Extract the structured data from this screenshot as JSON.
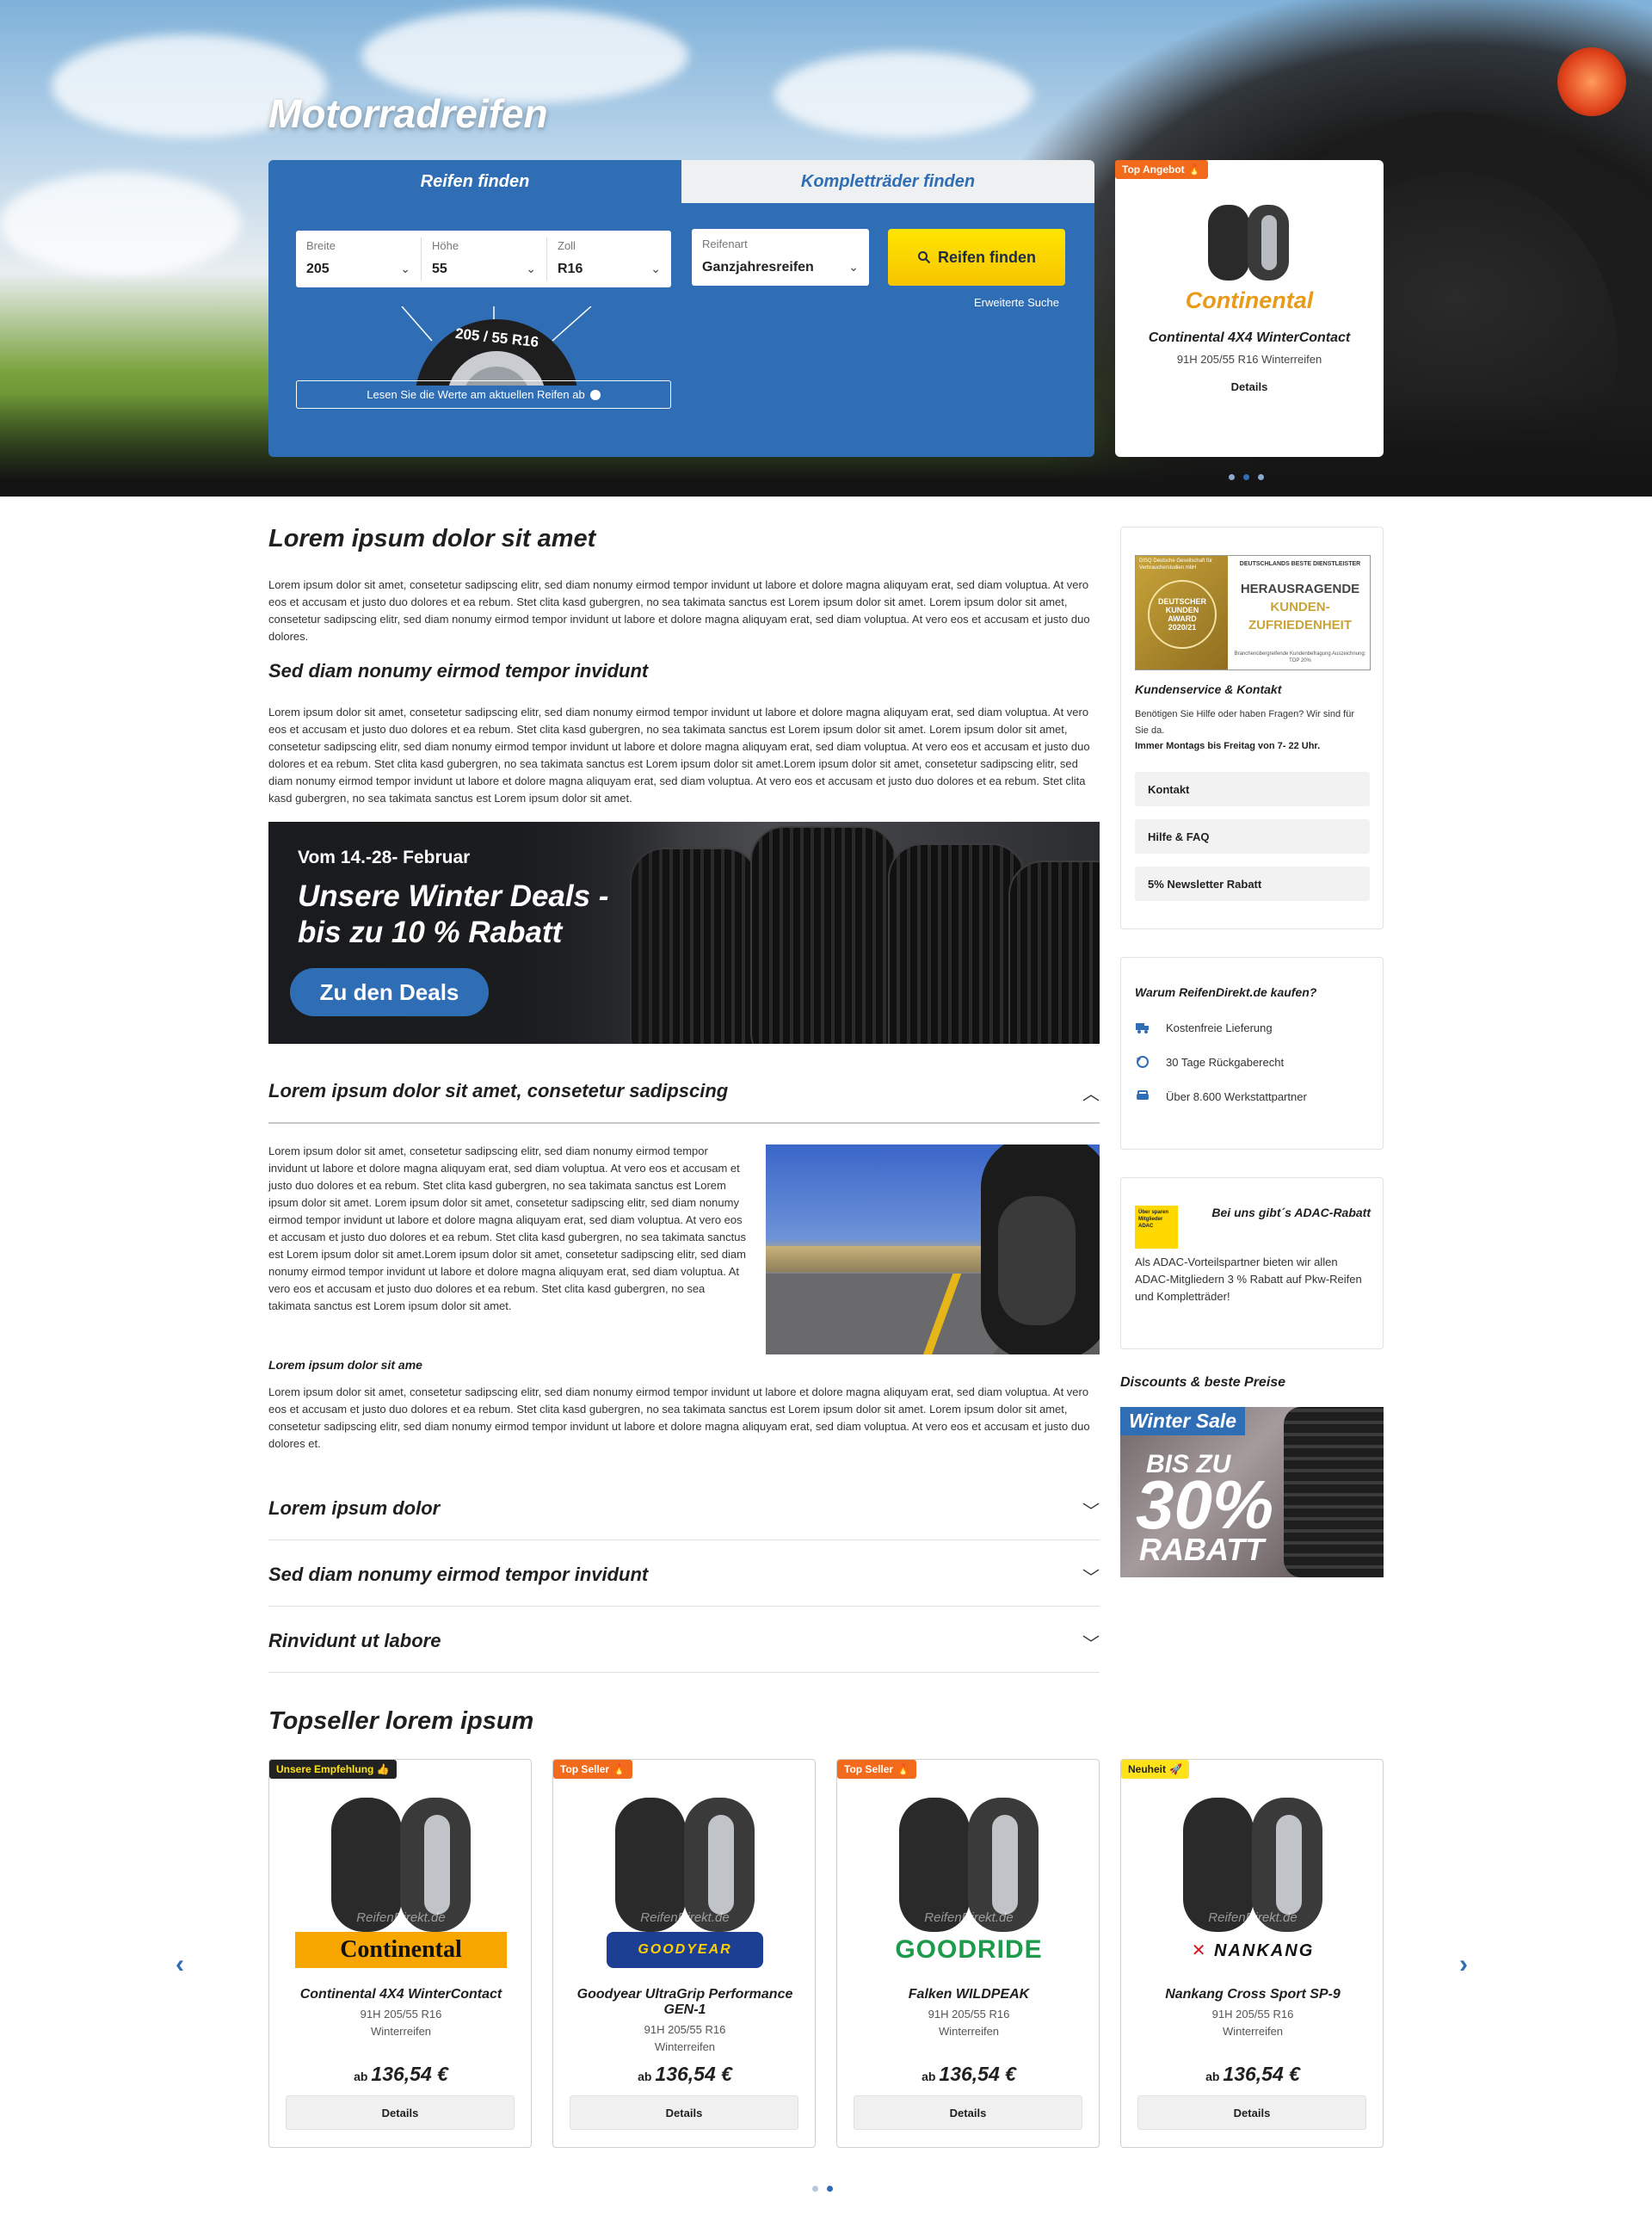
{
  "hero": {
    "title": "Motorradreifen",
    "tabs": [
      "Reifen finden",
      "Kompletträder finden"
    ],
    "fields": {
      "breite": {
        "label": "Breite",
        "value": "205"
      },
      "hoehe": {
        "label": "Höhe",
        "value": "55"
      },
      "zoll": {
        "label": "Zoll",
        "value": "R16"
      },
      "reifenart": {
        "label": "Reifenart",
        "value": "Ganzjahresreifen"
      }
    },
    "find_button": "Reifen finden",
    "advanced_search": "Erweiterte Suche",
    "tire_size_label": "205 / 55 R16",
    "read_values": "Lesen Sie die Werte am aktuellen Reifen ab"
  },
  "top_offer": {
    "badge": "Top Angebot",
    "brand": "Continental",
    "name": "Continental 4X4 WinterContact",
    "spec": "91H 205/55 R16 Winterreifen",
    "details": "Details"
  },
  "content": {
    "h1": "Lorem ipsum dolor sit amet",
    "p1": "Lorem ipsum dolor sit amet, consetetur sadipscing elitr, sed diam nonumy eirmod tempor invidunt ut labore et dolore magna aliquyam erat, sed diam voluptua. At vero eos et accusam et justo duo dolores et ea rebum. Stet clita kasd gubergren, no sea takimata sanctus est Lorem ipsum dolor sit amet. Lorem ipsum dolor sit amet, consetetur sadipscing elitr, sed diam nonumy eirmod tempor invidunt ut labore et dolore magna aliquyam erat, sed diam voluptua. At vero eos et accusam et justo duo dolores.",
    "h2": "Sed diam nonumy eirmod tempor invidunt",
    "p2": "Lorem ipsum dolor sit amet, consetetur sadipscing elitr, sed diam nonumy eirmod tempor invidunt ut labore et dolore magna aliquyam erat, sed diam voluptua. At vero eos et accusam et justo duo dolores et ea rebum. Stet clita kasd gubergren, no sea takimata sanctus est Lorem ipsum dolor sit amet. Lorem ipsum dolor sit amet, consetetur sadipscing elitr, sed diam nonumy eirmod tempor invidunt ut labore et dolore magna aliquyam erat, sed diam voluptua. At vero eos et accusam et justo duo dolores et ea rebum. Stet clita kasd gubergren, no sea takimata sanctus est Lorem ipsum dolor sit amet.Lorem ipsum dolor sit amet, consetetur sadipscing elitr, sed diam nonumy eirmod tempor invidunt ut labore et dolore magna aliquyam erat, sed diam voluptua. At vero eos et accusam et justo duo dolores et ea rebum. Stet clita kasd gubergren, no sea takimata sanctus est Lorem ipsum dolor sit amet.",
    "banner": {
      "date": "Vom 14.-28- Februar",
      "title": "Unsere Winter Deals - bis zu 10 % Rabatt",
      "button": "Zu den Deals"
    },
    "accordion_open": {
      "title": "Lorem ipsum dolor sit amet, consetetur sadipscing",
      "p": "Lorem ipsum dolor sit amet, consetetur sadipscing elitr, sed diam nonumy eirmod tempor invidunt ut labore et dolore magna aliquyam erat, sed diam voluptua. At vero eos et accusam et justo duo dolores et ea rebum. Stet clita kasd gubergren, no sea takimata sanctus est Lorem ipsum dolor sit amet. Lorem ipsum dolor sit amet, consetetur sadipscing elitr, sed diam nonumy eirmod tempor invidunt ut labore et dolore magna aliquyam erat, sed diam voluptua. At vero eos et accusam et justo duo dolores et ea rebum. Stet clita kasd gubergren, no sea takimata sanctus est Lorem ipsum dolor sit amet.Lorem ipsum dolor sit amet, consetetur sadipscing elitr, sed diam nonumy eirmod tempor invidunt ut labore et dolore magna aliquyam erat, sed diam voluptua. At vero eos et accusam et justo duo dolores et ea rebum. Stet clita kasd gubergren, no sea takimata sanctus est Lorem ipsum dolor sit amet.",
      "subhead": "Lorem ipsum dolor sit ame",
      "p2": "Lorem ipsum dolor sit amet, consetetur sadipscing elitr, sed diam nonumy eirmod tempor invidunt ut labore et dolore magna aliquyam erat, sed diam voluptua. At vero eos et accusam et justo duo dolores et ea rebum. Stet clita kasd gubergren, no sea takimata sanctus est Lorem ipsum dolor sit amet. Lorem ipsum dolor sit amet, consetetur sadipscing elitr, sed diam nonumy eirmod tempor invidunt ut labore et dolore magna aliquyam erat, sed diam voluptua. At vero eos et accusam et justo duo dolores et."
    },
    "accordion_closed": [
      "Lorem ipsum dolor",
      "Sed diam nonumy eirmod tempor invidunt",
      "Rinvidunt ut labore"
    ]
  },
  "sidebar": {
    "award": {
      "left_small": "DISQ Deutsche Gesellschaft für Verbraucherstudien mbH",
      "seal": "DEUTSCHER KUNDEN AWARD 2020/21",
      "top": "DEUTSCHLANDS BESTE DIENSTLEISTER",
      "main1": "HERAUSRAGENDE",
      "main2": "KUNDEN-",
      "main3": "ZUFRIEDENHEIT",
      "fine": "Branchenübergreifende Kundenbefragung Auszeichnung: TOP 20%"
    },
    "service_title": "Kundenservice & Kontakt",
    "service_text": "Benötigen Sie Hilfe oder haben Fragen? Wir sind für Sie da.",
    "service_hours": "Immer Montags bis Freitag von 7- 22 Uhr.",
    "links": [
      "Kontakt",
      "Hilfe & FAQ",
      "5% Newsletter Rabatt"
    ],
    "why_title": "Warum ReifenDirekt.de kaufen?",
    "features": [
      "Kostenfreie Lieferung",
      "30 Tage Rückgaberecht",
      "Über 8.600 Werkstattpartner"
    ],
    "adac_logo": "Über sparen Mitglieder ADAC",
    "adac_title": "Bei uns gibt´s ADAC-Rabatt",
    "adac_text": "Als ADAC-Vorteilspartner bieten wir allen ADAC-Mitgliedern 3 % Rabatt auf Pkw-Reifen und Kompletträder!",
    "discount_title": "Discounts & beste Preise",
    "sale": {
      "line1": "Winter Sale",
      "line2": "BIS ZU",
      "line3": "30%",
      "line4": "RABATT"
    }
  },
  "topseller": {
    "title": "Topseller lorem ipsum",
    "watermark": "ReifenDirekt.de",
    "products": [
      {
        "badge": "Unsere Empfehlung 👍",
        "brand": "Continental",
        "name": "Continental 4X4 WinterContact",
        "spec": "91H 205/55 R16",
        "type": "Winterreifen",
        "prefix": "ab",
        "price": "136,54 €",
        "details": "Details"
      },
      {
        "badge": "Top Seller",
        "brand": "GOODYEAR",
        "name": "Goodyear UltraGrip Performance GEN-1",
        "spec": "91H 205/55 R16",
        "type": "Winterreifen",
        "prefix": "ab",
        "price": "136,54 €",
        "details": "Details"
      },
      {
        "badge": "Top Seller",
        "brand": "GOODRIDE",
        "name": "Falken WILDPEAK",
        "spec": "91H 205/55 R16",
        "type": "Winterreifen",
        "prefix": "ab",
        "price": "136,54 €",
        "details": "Details"
      },
      {
        "badge": "Neuheit",
        "brand": "NANKANG",
        "name": "Nankang Cross Sport SP-9",
        "spec": "91H 205/55 R16",
        "type": "Winterreifen",
        "prefix": "ab",
        "price": "136,54 €",
        "details": "Details"
      }
    ]
  },
  "colors": {
    "primary": "#2f6eb5",
    "accent_yellow": "#ffe31a",
    "badge_orange": "#f26a1b"
  }
}
